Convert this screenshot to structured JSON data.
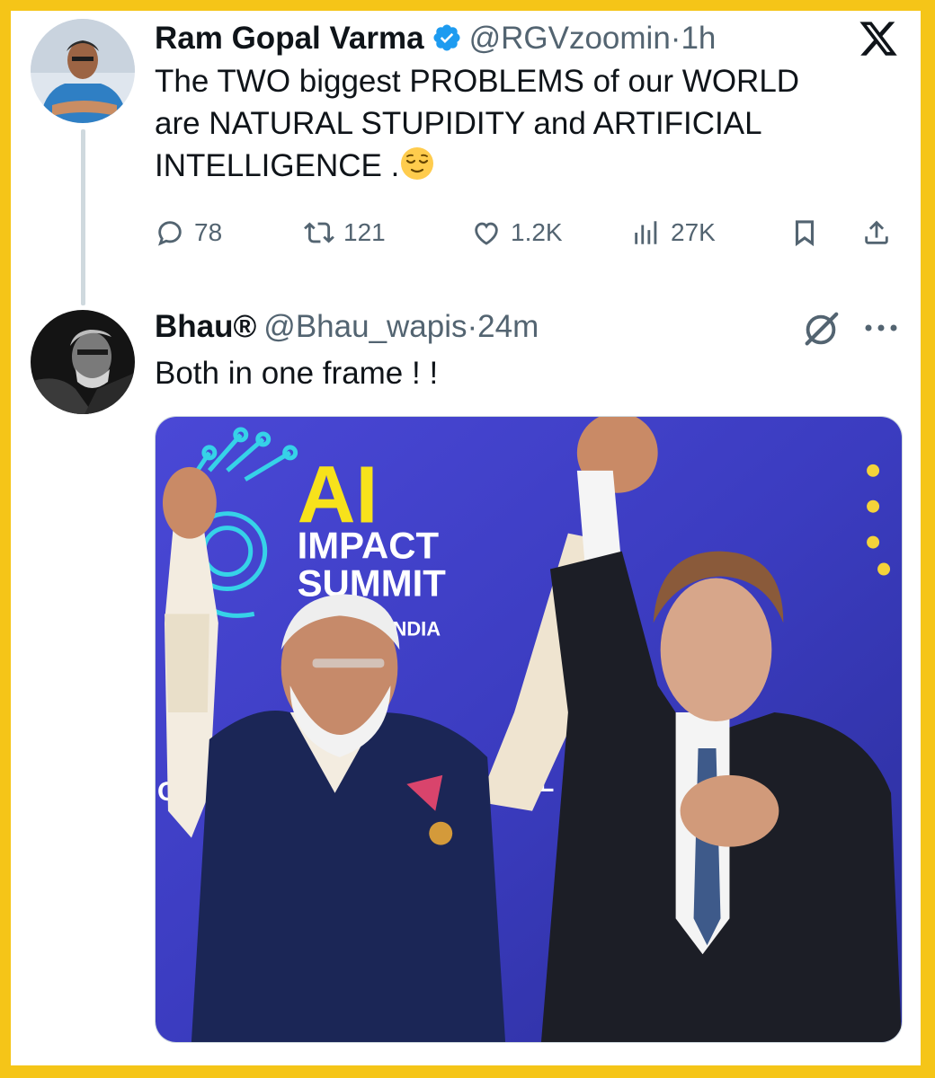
{
  "tweet": {
    "author_name": "Ram Gopal Varma",
    "handle": "@RGVzoomin",
    "separator": "·",
    "time": "1h",
    "line1": "The TWO biggest PROBLEMS of our  WORLD",
    "line2": "are NATURAL STUPIDITY and ARTIFICIAL",
    "line3": "INTELLIGENCE .",
    "emoji": "relieved-face",
    "replies": "78",
    "reposts": "121",
    "likes": "1.2K",
    "views": "27K"
  },
  "reply": {
    "author_name": "Bhau®",
    "handle": "@Bhau_wapis",
    "separator": "·",
    "time": "24m",
    "text": "Both in one frame ! !"
  },
  "media": {
    "sign_ai": "AI",
    "sign_impact": "IMPACT",
    "sign_summit": "SUMMIT",
    "sign_india": "INDIA",
    "sign_all": "ALL",
    "sign_or": "OR"
  },
  "colors": {
    "frame": "#f5c518",
    "verified": "#1d9bf0",
    "muted": "#536471",
    "stage": "#3d3fc4"
  },
  "icons": [
    "verified-badge-icon",
    "x-logo-icon",
    "reply-icon",
    "repost-icon",
    "like-icon",
    "views-icon",
    "bookmark-icon",
    "share-icon",
    "grok-icon",
    "more-icon"
  ]
}
